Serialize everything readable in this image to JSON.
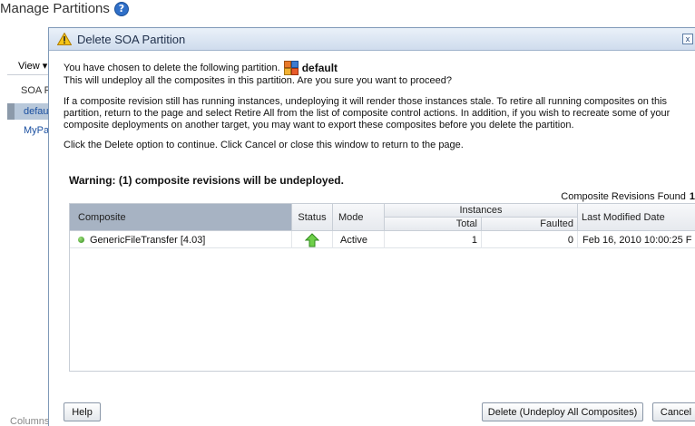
{
  "page": {
    "title": "Manage Partitions",
    "help_glyph": "?",
    "view_label": "View ▾",
    "soa_col": "SOA P",
    "rows": [
      "defau",
      "MyPa"
    ],
    "columns_label": "Columns"
  },
  "dialog": {
    "title": "Delete SOA Partition",
    "close_glyph": "x",
    "line1": "You have chosen to delete the following partition.",
    "partition_name": "default",
    "line2": "This will undeploy all the composites in this partition. Are you sure you want to proceed?",
    "para": "If a composite revision still has running instances, undeploying it will render those instances stale. To retire all running composites on this partition, return to the page and select Retire All from the list of composite control actions. In addition, if you wish to recreate some of your composite deployments on another target, you may want to export these composites before you delete the partition.",
    "click_line": "Click the Delete option to continue. Click Cancel or close this window to return to the page.",
    "warning": "Warning: (1) composite revisions will be undeployed.",
    "found_label": "Composite Revisions Found",
    "found_value": "1",
    "table": {
      "headers": {
        "composite": "Composite",
        "status": "Status",
        "mode": "Mode",
        "instances": "Instances",
        "total": "Total",
        "faulted": "Faulted",
        "last_modified": "Last Modified Date"
      },
      "rows": [
        {
          "composite": "GenericFileTransfer [4.03]",
          "status_icon": "up-arrow-icon",
          "mode": "Active",
          "total": "1",
          "faulted": "0",
          "last_modified": "Feb 16, 2010 10:00:25 F"
        }
      ]
    },
    "buttons": {
      "help": "Help",
      "delete": "Delete (Undeploy All Composites)",
      "cancel": "Cancel"
    }
  },
  "colors": {
    "accent": "#2f6fc8",
    "title_bar": "#cfdced",
    "sorted_header": "#a7b3c3",
    "active_green": "#3fa52a"
  }
}
